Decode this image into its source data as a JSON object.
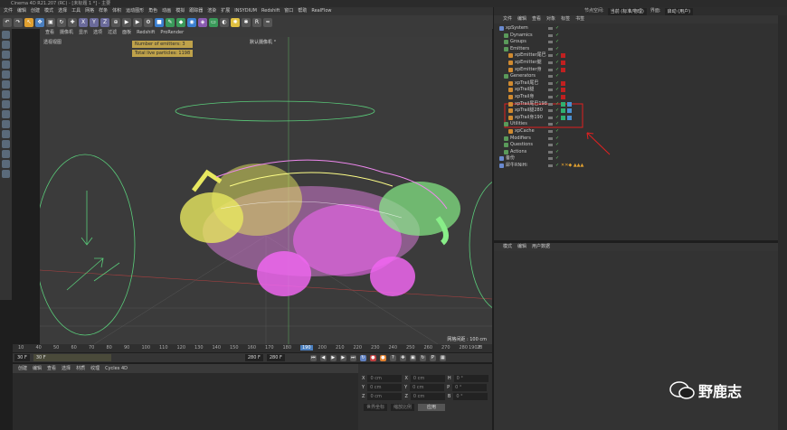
{
  "window": {
    "title": "Cinema 4D R21.207 (RC) - [未标题 1 *] - 主要"
  },
  "menubar": [
    "文件",
    "编辑",
    "创建",
    "模式",
    "选择",
    "工具",
    "网格",
    "样条",
    "体积",
    "运动图形",
    "角色",
    "动画",
    "模拟",
    "跟踪器",
    "渲染",
    "扩展",
    "INSYDIUM",
    "Redshift",
    "窗口",
    "帮助",
    "RealFlow"
  ],
  "toolbar": {
    "xyz": [
      "X",
      "Y",
      "Z"
    ]
  },
  "viewport": {
    "menu": [
      "查看",
      "摄像机",
      "显示",
      "选项",
      "过滤",
      "面板",
      "Redshift",
      "ProRender"
    ],
    "label": "透视视图",
    "camera": "默认摄像机 °",
    "hud": [
      "Number of emitters: 3",
      "Total live particles: 1198"
    ],
    "grid_distance": "网格间距 : 100 cm"
  },
  "timeline": {
    "ticks": [
      "10",
      "40",
      "50",
      "60",
      "70",
      "80",
      "90",
      "100",
      "110",
      "120",
      "130",
      "140",
      "150",
      "160",
      "170",
      "180",
      "190",
      "200",
      "210",
      "220",
      "230",
      "240",
      "250",
      "260",
      "270",
      "280",
      "28"
    ],
    "playhead": "190",
    "end_label": "190 F",
    "start_frame": "30 F",
    "current_frame": "30 F",
    "max_frame": "280 F",
    "max_frame2": "280 F"
  },
  "materials": {
    "menu": [
      "创建",
      "编辑",
      "查看",
      "选择",
      "材质",
      "纹理",
      "Cycles 4D"
    ]
  },
  "coords": {
    "rows": [
      {
        "axis": "X",
        "pos": "0 cm",
        "axis2": "X",
        "size": "0 cm",
        "axis3": "H",
        "rot": "0 °"
      },
      {
        "axis": "Y",
        "pos": "0 cm",
        "axis2": "Y",
        "size": "0 cm",
        "axis3": "P",
        "rot": "0 °"
      },
      {
        "axis": "Z",
        "pos": "0 cm",
        "axis2": "Z",
        "size": "0 cm",
        "axis3": "B",
        "rot": "0 °"
      }
    ],
    "mode1": "世界坐标",
    "mode2": "缩放比例",
    "apply": "应用"
  },
  "right": {
    "layout": "节点空间:",
    "layout_value": "当前 (标准/物理)",
    "interface": "界面:",
    "interface_value": "启动 (用户)",
    "om_menu": [
      "文件",
      "编辑",
      "查看",
      "对象",
      "标签",
      "书签"
    ],
    "attr_menu": [
      "模式",
      "编辑",
      "用户数据"
    ]
  },
  "objects": [
    {
      "name": "xpSystem",
      "indent": 0
    },
    {
      "name": "Dynamics",
      "indent": 1
    },
    {
      "name": "Groups",
      "indent": 1
    },
    {
      "name": "Emitters",
      "indent": 1
    },
    {
      "name": "xpEmitter尾巴",
      "indent": 2
    },
    {
      "name": "xpEmitter腿",
      "indent": 2
    },
    {
      "name": "xpEmitter身",
      "indent": 2
    },
    {
      "name": "Generators",
      "indent": 1
    },
    {
      "name": "xpTrail尾巴",
      "indent": 2
    },
    {
      "name": "xpTrail腿",
      "indent": 2
    },
    {
      "name": "xpTrail身",
      "indent": 2
    },
    {
      "name": "xpTrail尾巴198",
      "indent": 2
    },
    {
      "name": "xpTrail腿280",
      "indent": 2
    },
    {
      "name": "xpTrail身190",
      "indent": 2
    },
    {
      "name": "Utilities",
      "indent": 1
    },
    {
      "name": "xpCache",
      "indent": 2
    },
    {
      "name": "Modifiers",
      "indent": 1
    },
    {
      "name": "Questions",
      "indent": 1
    },
    {
      "name": "Actions",
      "indent": 1
    },
    {
      "name": "备份",
      "indent": 0
    },
    {
      "name": "犀牛RNiHi",
      "indent": 0
    }
  ],
  "watermark": "野鹿志",
  "colors": {
    "accent": "#e0a030",
    "highlight_box": "#e02020",
    "hud": "#bfa24a"
  }
}
